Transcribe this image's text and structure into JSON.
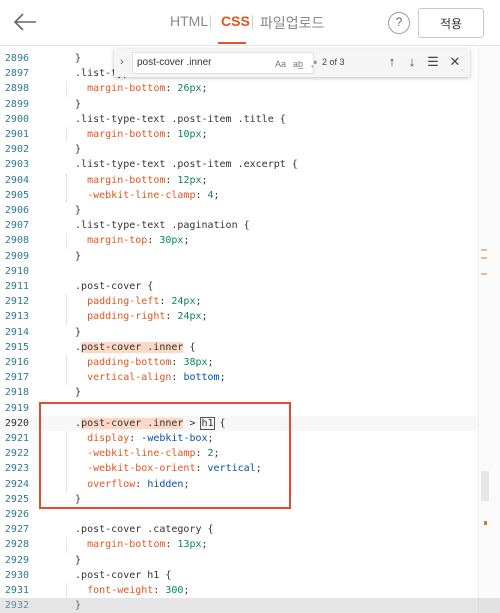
{
  "header": {
    "back_icon": "arrow-left-icon",
    "tabs": [
      {
        "label": "HTML",
        "active": false
      },
      {
        "label": "CSS",
        "active": true
      },
      {
        "label": "파일업로드",
        "active": false
      }
    ],
    "help_label": "?",
    "apply_label": "적용",
    "accent": "#e2551f"
  },
  "find": {
    "toggle": "›",
    "query": "post-cover .inner",
    "match_case": "Aa",
    "whole_word": "ab̲",
    "regex": ".*",
    "count": "2 of 3",
    "prev": "↑",
    "next": "↓",
    "selection": "☰",
    "close": "✕"
  },
  "editor": {
    "lines": [
      {
        "n": "2896",
        "t": "  }"
      },
      {
        "n": "2897",
        "t": "  .list-type"
      },
      {
        "n": "2898",
        "t": "    margin-bottom: 26px;"
      },
      {
        "n": "2899",
        "t": "  }"
      },
      {
        "n": "2900",
        "t": "  .list-type-text .post-item .title {"
      },
      {
        "n": "2901",
        "t": "    margin-bottom: 10px;"
      },
      {
        "n": "2902",
        "t": "  }"
      },
      {
        "n": "2903",
        "t": "  .list-type-text .post-item .excerpt {"
      },
      {
        "n": "2904",
        "t": "    margin-bottom: 12px;"
      },
      {
        "n": "2905",
        "t": "    -webkit-line-clamp: 4;"
      },
      {
        "n": "2906",
        "t": "  }"
      },
      {
        "n": "2907",
        "t": "  .list-type-text .pagination {"
      },
      {
        "n": "2908",
        "t": "    margin-top: 30px;"
      },
      {
        "n": "2909",
        "t": "  }"
      },
      {
        "n": "2910",
        "t": ""
      },
      {
        "n": "2911",
        "t": "  .post-cover {"
      },
      {
        "n": "2912",
        "t": "    padding-left: 24px;"
      },
      {
        "n": "2913",
        "t": "    padding-right: 24px;"
      },
      {
        "n": "2914",
        "t": "  }"
      },
      {
        "n": "2915",
        "t": "  .post-cover .inner {"
      },
      {
        "n": "2916",
        "t": "    padding-bottom: 38px;"
      },
      {
        "n": "2917",
        "t": "    vertical-align: bottom;"
      },
      {
        "n": "2918",
        "t": "  }"
      },
      {
        "n": "2919",
        "t": ""
      },
      {
        "n": "2920",
        "t": "  .post-cover .inner > h1 {"
      },
      {
        "n": "2921",
        "t": "    display: -webkit-box;"
      },
      {
        "n": "2922",
        "t": "    -webkit-line-clamp: 2;"
      },
      {
        "n": "2923",
        "t": "    -webkit-box-orient: vertical;"
      },
      {
        "n": "2924",
        "t": "    overflow: hidden;"
      },
      {
        "n": "2925",
        "t": "  }"
      },
      {
        "n": "2926",
        "t": ""
      },
      {
        "n": "2927",
        "t": "  .post-cover .category {"
      },
      {
        "n": "2928",
        "t": "    margin-bottom: 13px;"
      },
      {
        "n": "2929",
        "t": "  }"
      },
      {
        "n": "2930",
        "t": "  .post-cover h1 {"
      },
      {
        "n": "2931",
        "t": "    font-weight: 300;"
      },
      {
        "n": "2932",
        "t": "  }"
      }
    ],
    "current_line": "2920"
  }
}
